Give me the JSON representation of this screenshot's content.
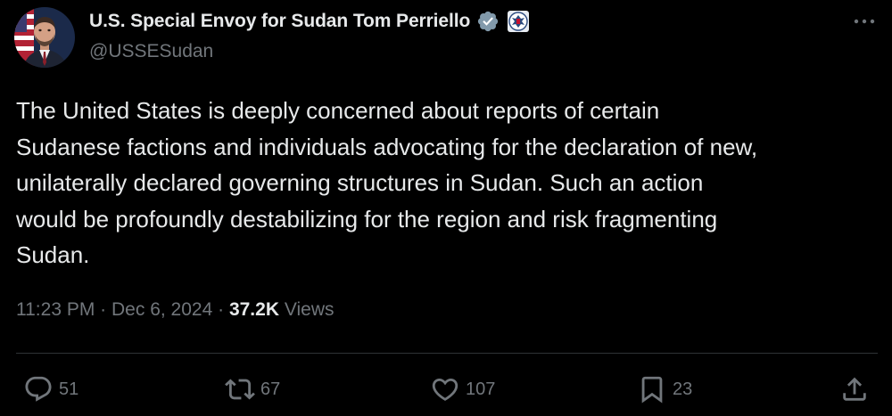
{
  "author": {
    "display_name": "U.S. Special Envoy for Sudan Tom Perriello",
    "handle": "@USSESudan",
    "verified_badge_icon": "verified-check-icon",
    "affiliate_badge_icon": "state-department-seal-icon"
  },
  "tweet": {
    "text": "The United States is deeply concerned about reports of certain\nSudanese factions and individuals advocating for the declaration of new,\nunilaterally declared governing structures in Sudan. Such an action\nwould be profoundly destabilizing for the region and risk fragmenting\nSudan."
  },
  "meta": {
    "time": "11:23 PM",
    "separator": "·",
    "date": "Dec 6, 2024",
    "views_count": "37.2K",
    "views_label": "Views"
  },
  "actions": {
    "reply_count": "51",
    "repost_count": "67",
    "like_count": "107",
    "bookmark_count": "23"
  },
  "colors": {
    "background": "#000000",
    "text_primary": "#e7e9ea",
    "text_secondary": "#71767b",
    "divider": "#2f3336",
    "verified": "#829aab"
  }
}
